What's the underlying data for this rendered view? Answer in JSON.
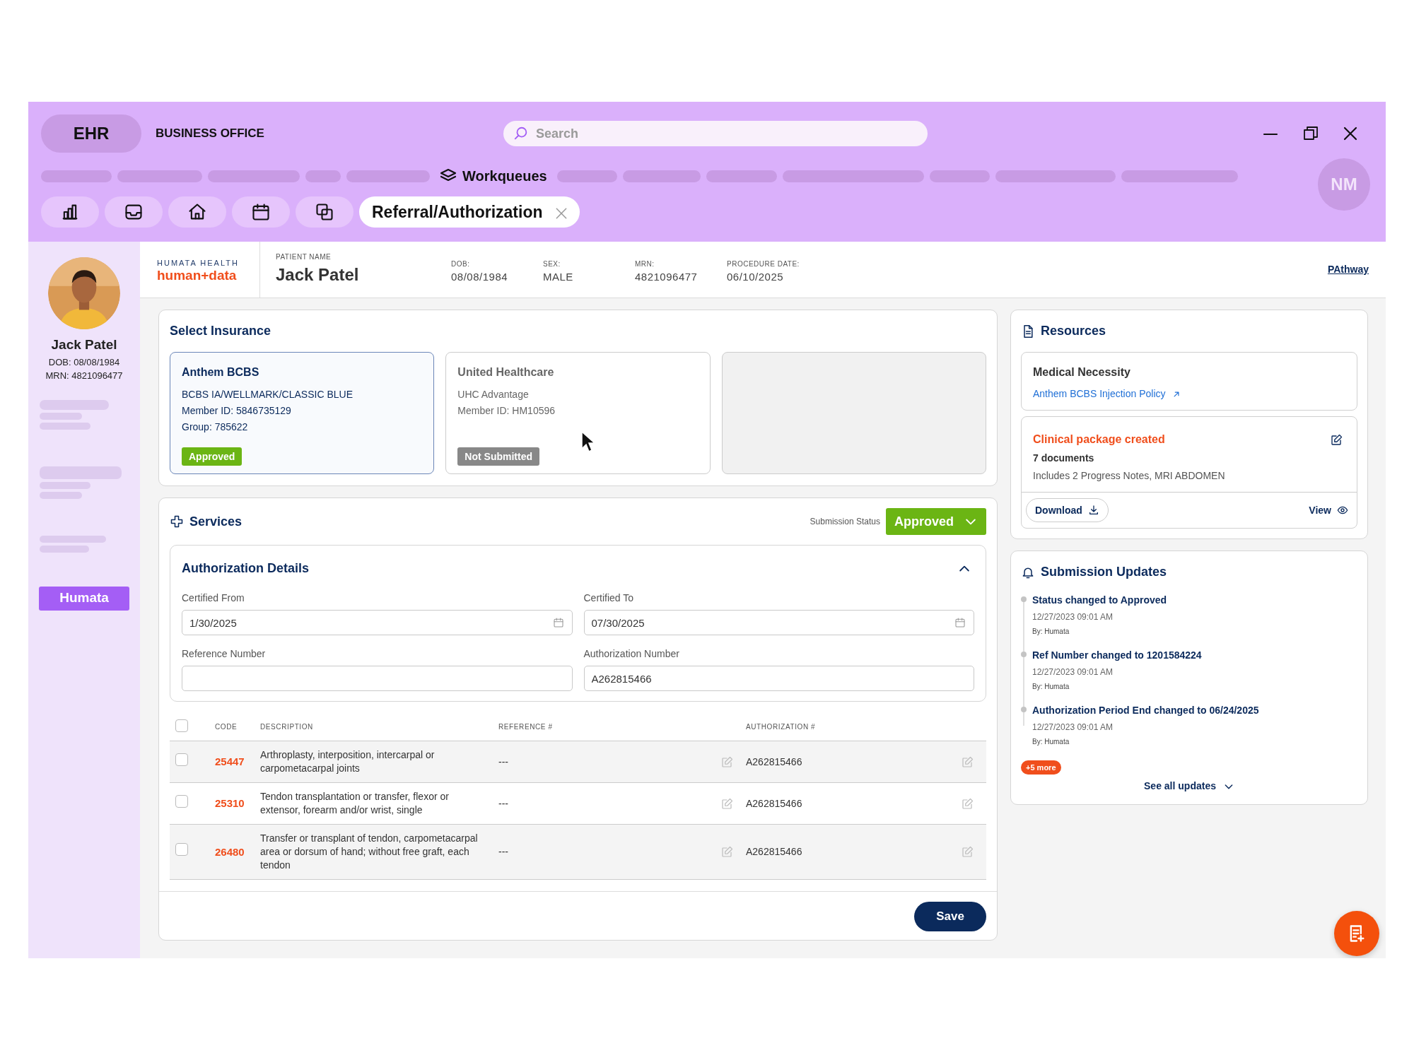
{
  "app": {
    "name": "EHR",
    "section": "BUSINESS OFFICE",
    "search": {
      "placeholder": "Search"
    },
    "user_initials": "NM"
  },
  "nav": {
    "items": [
      {
        "label": "Workqueues"
      }
    ]
  },
  "tabs": [
    {
      "label": "Referral/Authorization",
      "selected": true
    }
  ],
  "sidebar": {
    "patient_name": "Jack Patel",
    "dob": "DOB: 08/08/1984",
    "mrn": "MRN: 4821096477",
    "button": "Humata"
  },
  "header": {
    "brand_top": "HUMATA HEALTH",
    "brand": "human+data",
    "fields": [
      {
        "label": "PATIENT NAME",
        "value": "Jack Patel",
        "kind": "name"
      },
      {
        "label": "DOB:",
        "value": "08/08/1984",
        "kind": "plain"
      },
      {
        "label": "SEX:",
        "value": "MALE",
        "kind": "plain"
      },
      {
        "label": "MRN:",
        "value": "4821096477",
        "kind": "plain"
      },
      {
        "label": "PROCEDURE DATE:",
        "value": "06/10/2025",
        "kind": "plain"
      }
    ],
    "link": "PAthway"
  },
  "insurance": {
    "title": "Select Insurance",
    "cards": [
      {
        "kind": "insurance",
        "selected": true,
        "name": "Anthem BCBS",
        "lines": [
          "BCBS IA/WELLMARK/CLASSIC BLUE",
          "Member ID: 5846735129",
          "Group: 785622"
        ],
        "status": {
          "text": "Approved",
          "kind": "approved"
        }
      },
      {
        "kind": "insurance",
        "selected": false,
        "name": "United Healthcare",
        "lines": [
          "UHC Advantage",
          "Member ID: HM10596"
        ],
        "status": {
          "text": "Not Submitted",
          "kind": "not_submitted"
        }
      },
      {
        "kind": "empty"
      }
    ]
  },
  "services": {
    "title": "Services",
    "status_label": "Submission Status",
    "status": {
      "text": "Approved",
      "kind": "approved"
    },
    "auth": {
      "title": "Authorization Details",
      "expanded": true,
      "fields": [
        {
          "label": "Certified From",
          "value": "1/30/2025",
          "kind": "date"
        },
        {
          "label": "Certified To",
          "value": "07/30/2025",
          "kind": "date"
        },
        {
          "label": "Reference Number",
          "kind": "text"
        },
        {
          "label": "Authorization Number",
          "value": "A262815466",
          "kind": "text"
        }
      ]
    },
    "table": {
      "header_checked": false,
      "columns": [
        "CODE",
        "DESCRIPTION",
        "REFERENCE #",
        "AUTHORIZATION #"
      ],
      "rows": [
        {
          "checked": false,
          "code": "25447",
          "description": "Arthroplasty, interposition, intercarpal or carpometacarpal joints",
          "reference": "---",
          "authorization": "A262815466"
        },
        {
          "checked": false,
          "code": "25310",
          "description": "Tendon transplantation or transfer, flexor or extensor, forearm and/or wrist, single",
          "reference": "---",
          "authorization": "A262815466"
        },
        {
          "checked": false,
          "code": "26480",
          "description": "Transfer or transplant of tendon, carpometacarpal area or dorsum of hand; without free graft, each tendon",
          "reference": "---",
          "authorization": "A262815466"
        }
      ]
    },
    "save": "Save"
  },
  "resources": {
    "title": "Resources",
    "necessity": {
      "title": "Medical Necessity",
      "link": "Anthem BCBS Injection Policy"
    },
    "package": {
      "title": "Clinical package created",
      "count": "7 documents",
      "details": "Includes 2 Progress Notes, MRI ABDOMEN",
      "download": "Download",
      "view": "View"
    }
  },
  "updates": {
    "title": "Submission Updates",
    "items": [
      {
        "title": "Status changed to Approved",
        "time": "12/27/2023 09:01 AM",
        "by": "By: Humata"
      },
      {
        "title": "Ref Number changed to 1201584224",
        "time": "12/27/2023 09:01 AM",
        "by": "By: Humata"
      },
      {
        "title": "Authorization Period End changed to 06/24/2025",
        "time": "12/27/2023 09:01 AM",
        "by": "By: Humata"
      }
    ],
    "more": "+5 more",
    "see_all": "See all updates"
  }
}
